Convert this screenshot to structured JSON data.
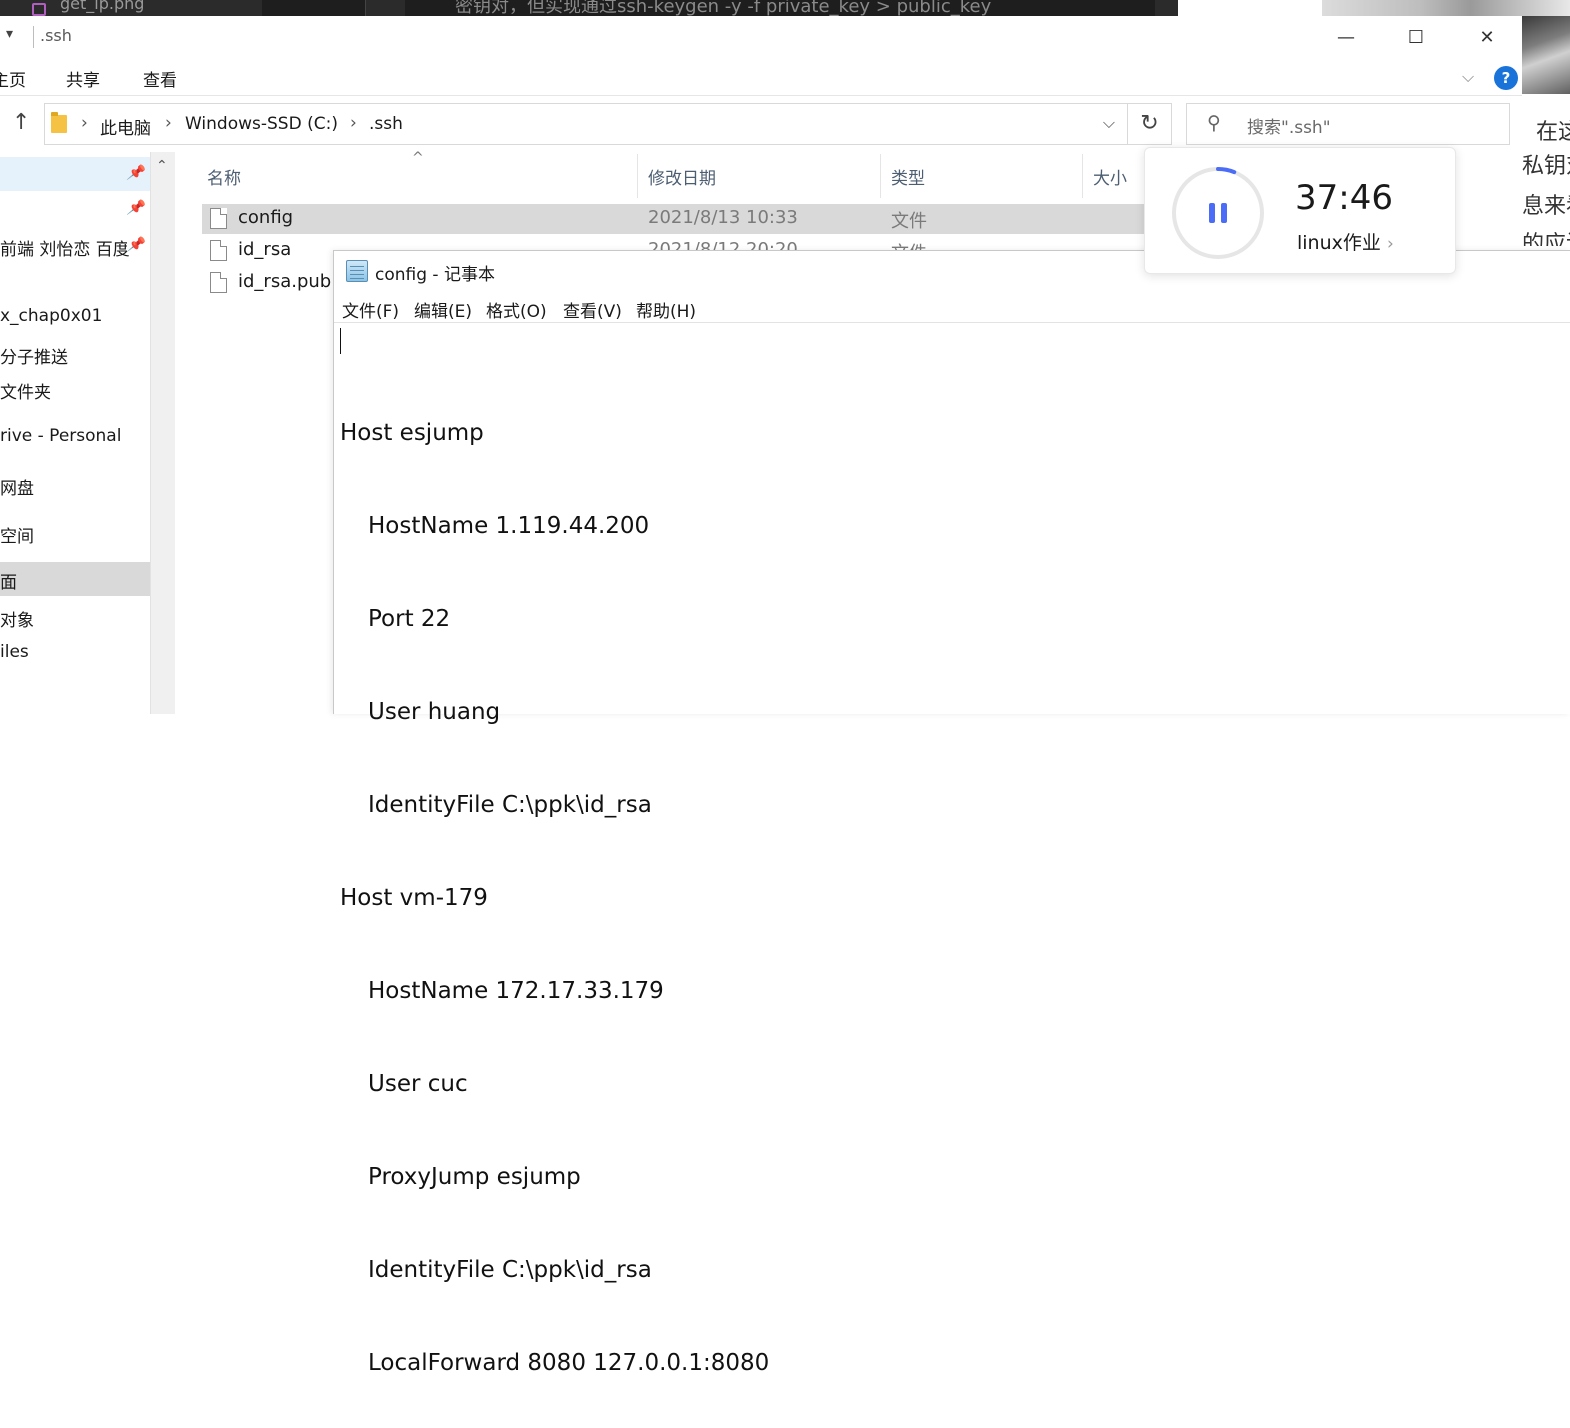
{
  "background": {
    "top_tab_file": "get_ip.png",
    "top_text": "密钥对，但实现通过ssh-keygen -y -f private_key > public_key",
    "right_page_lines": [
      "在这",
      "私钥对",
      "息来看",
      "的应该"
    ]
  },
  "explorer": {
    "window_title": ".ssh",
    "quick_access_glyph": "▾",
    "window_buttons": {
      "minimize": "—",
      "maximize": "☐",
      "close": "✕"
    },
    "ribbon_tabs": [
      "主页",
      "共享",
      "查看"
    ],
    "address": {
      "crumbs": [
        "此电脑",
        "Windows-SSD (C:)",
        ".ssh"
      ],
      "separator": "›"
    },
    "search_placeholder": "搜索\".ssh\"",
    "nav_items": [
      {
        "label": "",
        "pinned": true
      },
      {
        "label": "",
        "pinned": true
      },
      {
        "label": "前端 刘怡恋 百度",
        "pinned": true
      },
      {
        "label": "x_chap0x01",
        "pinned": false
      },
      {
        "label": "分子推送",
        "pinned": false
      },
      {
        "label": "文件夹",
        "pinned": false
      },
      {
        "label": "rive - Personal",
        "pinned": false
      },
      {
        "label": "网盘",
        "pinned": false
      },
      {
        "label": "空间",
        "pinned": false
      },
      {
        "label": "面",
        "pinned": false
      },
      {
        "label": "对象",
        "pinned": false
      },
      {
        "label": "iles",
        "pinned": false
      }
    ],
    "columns": [
      "名称",
      "修改日期",
      "类型",
      "大小"
    ],
    "files": [
      {
        "name": "config",
        "date": "2021/8/13 10:33",
        "type": "文件",
        "selected": true
      },
      {
        "name": "id_rsa",
        "date": "2021/8/12 20:20",
        "type": "文件",
        "selected": false
      },
      {
        "name": "id_rsa.pub",
        "date": "",
        "type": "",
        "selected": false
      }
    ]
  },
  "notepad": {
    "title": "config - 记事本",
    "menu": [
      "文件(F)",
      "编辑(E)",
      "格式(O)",
      "查看(V)",
      "帮助(H)"
    ],
    "lines": [
      {
        "text": "Host esjump",
        "indent": false
      },
      {
        "text": "HostName 1.119.44.200",
        "indent": true
      },
      {
        "text": "Port 22",
        "indent": true
      },
      {
        "text": "User huang",
        "indent": true
      },
      {
        "text": "IdentityFile C:\\ppk\\id_rsa",
        "indent": true
      },
      {
        "text": "Host vm-179",
        "indent": false
      },
      {
        "text": "HostName 172.17.33.179",
        "indent": true
      },
      {
        "text": "User cuc",
        "indent": true
      },
      {
        "text": "ProxyJump esjump",
        "indent": true
      },
      {
        "text": "IdentityFile C:\\ppk\\id_rsa",
        "indent": true
      },
      {
        "text": "LocalForward 8080 127.0.0.1:8080",
        "indent": true
      }
    ]
  },
  "timer": {
    "time": "37:46",
    "label": "linux作业",
    "label_chevron": "›",
    "progress_fraction": 0.06,
    "accent_color": "#4a6cf7",
    "track_color": "#e6e6e6",
    "state": "paused"
  },
  "colors": {
    "selection": "#d9d9d9",
    "nav_highlight": "#e5f1fb",
    "help_blue": "#1a73d9"
  }
}
